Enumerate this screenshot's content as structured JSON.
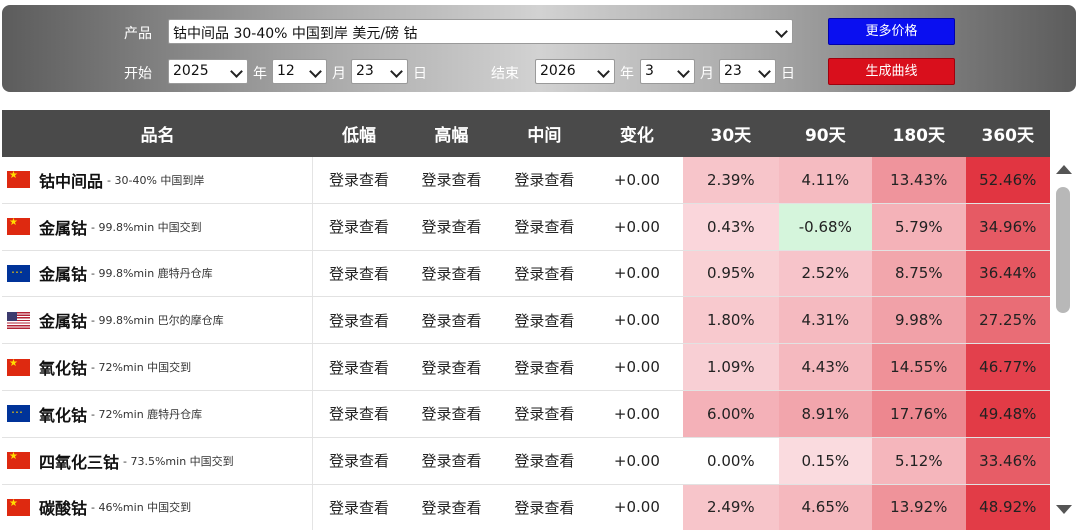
{
  "filters": {
    "product_label": "产品",
    "product_value": "钴中间品 30-40% 中国到岸 美元/磅 钴",
    "start_label": "开始",
    "start_year": "2025",
    "start_month": "12",
    "start_day": "23",
    "end_label": "结束",
    "end_year": "2026",
    "end_month": "3",
    "end_day": "23",
    "year_unit": "年",
    "month_unit": "月",
    "day_unit": "日",
    "more_prices_button": "更多价格",
    "generate_curve_button": "生成曲线"
  },
  "table": {
    "headers": {
      "name": "品名",
      "low": "低幅",
      "high": "高幅",
      "mid": "中间",
      "change": "变化",
      "d30": "30天",
      "d90": "90天",
      "d180": "180天",
      "d360": "360天"
    },
    "rows": [
      {
        "flag": "china-flag-icon",
        "name": "钴中间品",
        "desc": "- 30-40% 中国到岸",
        "low": "登录查看",
        "high": "登录查看",
        "mid": "登录查看",
        "change": "+0.00",
        "d30": "2.39%",
        "d90": "4.11%",
        "d180": "13.43%",
        "d360": "52.46%"
      },
      {
        "flag": "china-flag-icon",
        "name": "金属钴",
        "desc": "- 99.8%min 中国交到",
        "low": "登录查看",
        "high": "登录查看",
        "mid": "登录查看",
        "change": "+0.00",
        "d30": "0.43%",
        "d90": "-0.68%",
        "d180": "5.79%",
        "d360": "34.96%"
      },
      {
        "flag": "eu-flag-icon",
        "name": "金属钴",
        "desc": "- 99.8%min 鹿特丹仓库",
        "low": "登录查看",
        "high": "登录查看",
        "mid": "登录查看",
        "change": "+0.00",
        "d30": "0.95%",
        "d90": "2.52%",
        "d180": "8.75%",
        "d360": "36.44%"
      },
      {
        "flag": "us-flag-icon",
        "name": "金属钴",
        "desc": "- 99.8%min 巴尔的摩仓库",
        "low": "登录查看",
        "high": "登录查看",
        "mid": "登录查看",
        "change": "+0.00",
        "d30": "1.80%",
        "d90": "4.31%",
        "d180": "9.98%",
        "d360": "27.25%"
      },
      {
        "flag": "china-flag-icon",
        "name": "氧化钴",
        "desc": "- 72%min 中国交到",
        "low": "登录查看",
        "high": "登录查看",
        "mid": "登录查看",
        "change": "+0.00",
        "d30": "1.09%",
        "d90": "4.43%",
        "d180": "14.55%",
        "d360": "46.77%"
      },
      {
        "flag": "eu-flag-icon",
        "name": "氧化钴",
        "desc": "- 72%min 鹿特丹仓库",
        "low": "登录查看",
        "high": "登录查看",
        "mid": "登录查看",
        "change": "+0.00",
        "d30": "6.00%",
        "d90": "8.91%",
        "d180": "17.76%",
        "d360": "49.48%"
      },
      {
        "flag": "china-flag-icon",
        "name": "四氧化三钴",
        "desc": "- 73.5%min 中国交到",
        "low": "登录查看",
        "high": "登录查看",
        "mid": "登录查看",
        "change": "+0.00",
        "d30": "0.00%",
        "d90": "0.15%",
        "d180": "5.12%",
        "d360": "33.46%"
      },
      {
        "flag": "china-flag-icon",
        "name": "碳酸钴",
        "desc": "- 46%min 中国交到",
        "low": "登录查看",
        "high": "登录查看",
        "mid": "登录查看",
        "change": "+0.00",
        "d30": "2.49%",
        "d90": "4.65%",
        "d180": "13.92%",
        "d360": "48.92%"
      }
    ]
  },
  "colors": {
    "header_bg": "#4a4a4a",
    "more_prices_blue": "#0a0ff0",
    "generate_curve_red": "#d90f1c",
    "negative_cell_green": "#d5f5dc",
    "heat_light": "#fbe0e4",
    "heat_dark": "#e0303c"
  }
}
